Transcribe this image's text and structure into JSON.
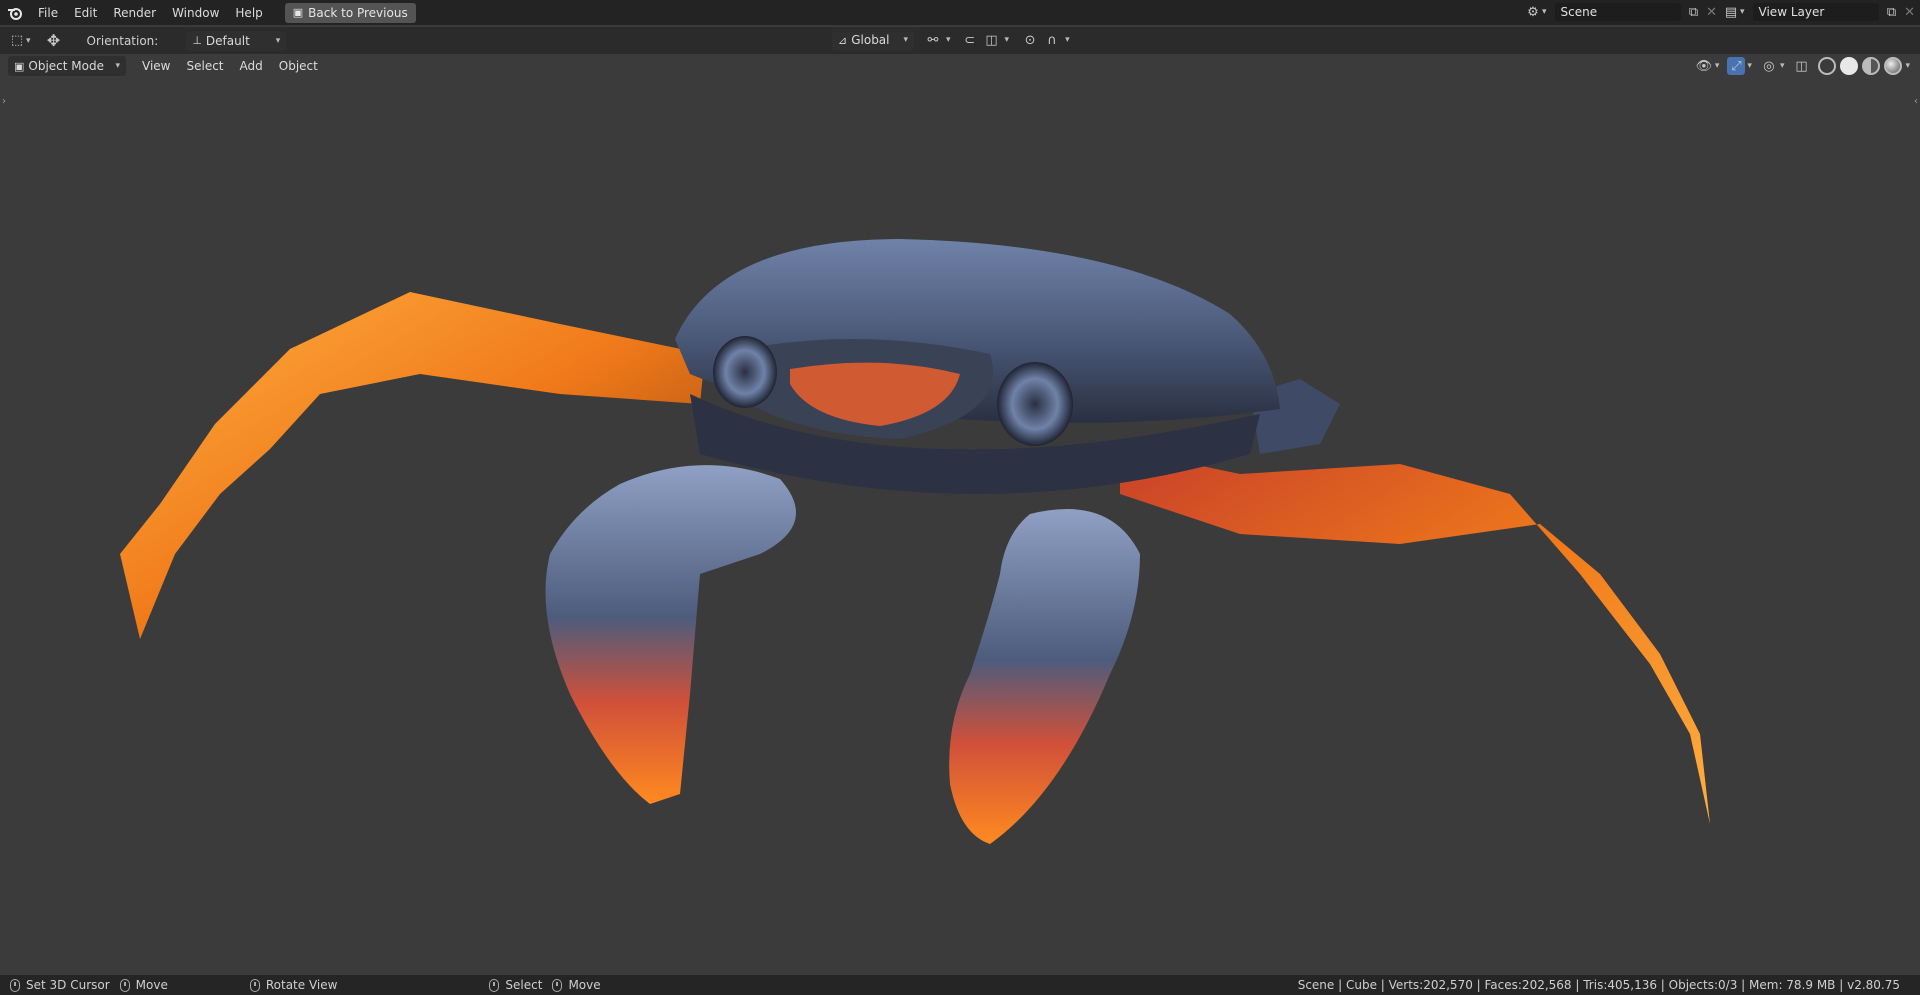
{
  "topbar": {
    "menus": [
      "File",
      "Edit",
      "Render",
      "Window",
      "Help"
    ],
    "back_button": "Back to Previous",
    "scene_field": "Scene",
    "view_layer_field": "View Layer",
    "icons": {
      "app": "blender-logo-icon",
      "back": "back-screen-icon",
      "scene": "scene-icon",
      "new": "duplicate-icon",
      "close": "close-icon",
      "view_layer": "view-layer-icon"
    }
  },
  "tool_header": {
    "orientation_label": "Orientation:",
    "orientation_value": "Default",
    "transform_space": "Global",
    "icons": [
      "select-tool-icon",
      "move-tool-icon",
      "pivot-icon",
      "snap-icon",
      "proportional-edit-icon",
      "falloff-icon"
    ]
  },
  "view_header": {
    "mode": "Object Mode",
    "menus": [
      "View",
      "Select",
      "Add",
      "Object"
    ],
    "right_icons": [
      "visibility-icon",
      "gizmo-icon",
      "overlay-icon",
      "xray-icon",
      "wireframe-shading-icon",
      "solid-shading-icon",
      "material-shading-icon",
      "rendered-shading-icon"
    ]
  },
  "statusbar": {
    "items": [
      {
        "label": "Set 3D Cursor"
      },
      {
        "label": "Move"
      },
      {
        "label": "Rotate View"
      },
      {
        "label": "Select"
      },
      {
        "label": "Move"
      }
    ],
    "stats": "Scene | Cube | Verts:202,570 | Faces:202,568 | Tris:405,136 | Objects:0/3 | Mem: 78.9 MB | v2.80.75"
  },
  "colors": {
    "topbar_bg": "#232323",
    "viewport_bg": "#3b3b3b",
    "crab_shell": "#5a6b8c",
    "crab_orange": "#f07a1a",
    "crab_red": "#c8402a"
  }
}
